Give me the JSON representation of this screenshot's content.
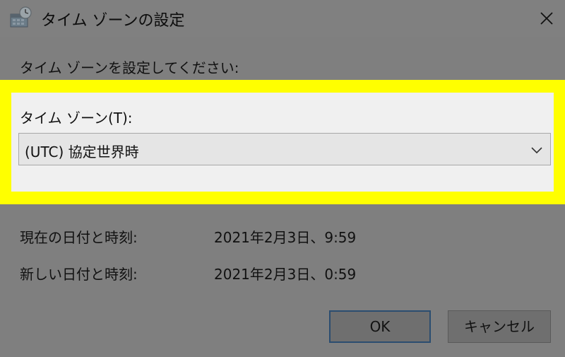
{
  "window": {
    "title": "タイム ゾーンの設定"
  },
  "dialog": {
    "prompt": "タイム ゾーンを設定してください:",
    "timezone": {
      "label": "タイム ゾーン(T):",
      "selected": "(UTC) 協定世界時"
    },
    "info": {
      "current_label": "現在の日付と時刻:",
      "current_value": "2021年2月3日、9:59",
      "new_label": "新しい日付と時刻:",
      "new_value": "2021年2月3日、0:59"
    },
    "buttons": {
      "ok": "OK",
      "cancel": "キャンセル"
    }
  },
  "colors": {
    "highlight": "#ffff00",
    "panel": "#f0f0f0",
    "dimmed_background": "#7f7f7f"
  },
  "icons": {
    "window": "date-time-clock-icon",
    "close": "close-icon",
    "dropdown": "chevron-down-icon"
  }
}
